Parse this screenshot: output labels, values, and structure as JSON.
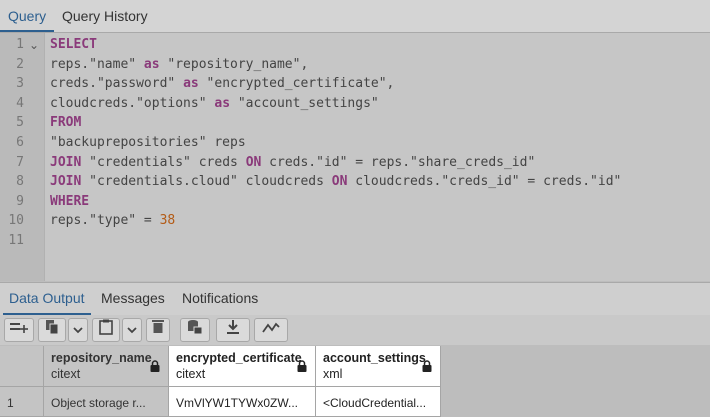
{
  "tabs": {
    "query": "Query",
    "history": "Query History"
  },
  "editor": {
    "line_numbers": [
      "1",
      "2",
      "3",
      "4",
      "5",
      "6",
      "7",
      "8",
      "9",
      "10",
      "11"
    ],
    "lines": [
      [
        {
          "t": "SELECT",
          "k": "kw"
        }
      ],
      [
        {
          "t": "reps.\"name\" "
        },
        {
          "t": "as",
          "k": "kw"
        },
        {
          "t": " \"repository_name\","
        }
      ],
      [
        {
          "t": "creds.\"password\" "
        },
        {
          "t": "as",
          "k": "kw"
        },
        {
          "t": " \"encrypted_certificate\","
        }
      ],
      [
        {
          "t": "cloudcreds.\"options\" "
        },
        {
          "t": "as",
          "k": "kw"
        },
        {
          "t": " \"account_settings\""
        }
      ],
      [
        {
          "t": "FROM",
          "k": "kw"
        }
      ],
      [
        {
          "t": "\"backuprepositories\" reps"
        }
      ],
      [
        {
          "t": "JOIN",
          "k": "kw"
        },
        {
          "t": " \"credentials\" creds "
        },
        {
          "t": "ON",
          "k": "kw"
        },
        {
          "t": " creds.\"id\" = reps.\"share_creds_id\""
        }
      ],
      [
        {
          "t": "JOIN",
          "k": "kw"
        },
        {
          "t": " \"credentials.cloud\" cloudcreds "
        },
        {
          "t": "ON",
          "k": "kw"
        },
        {
          "t": " cloudcreds.\"creds_id\" = creds.\"id\""
        }
      ],
      [
        {
          "t": "WHERE",
          "k": "kw"
        }
      ],
      [
        {
          "t": "reps.\"type\" = "
        },
        {
          "t": "38",
          "k": "num"
        }
      ],
      []
    ]
  },
  "output_tabs": {
    "data_output": "Data Output",
    "messages": "Messages",
    "notifications": "Notifications"
  },
  "grid": {
    "columns": [
      {
        "name": "repository_name",
        "type": "citext"
      },
      {
        "name": "encrypted_certificate",
        "type": "citext"
      },
      {
        "name": "account_settings",
        "type": "xml"
      }
    ],
    "rows": [
      {
        "num": "1",
        "cells": [
          "Object storage r...",
          "VmVlYW1TYWx0ZW...",
          "<CloudCredential..."
        ]
      }
    ]
  }
}
